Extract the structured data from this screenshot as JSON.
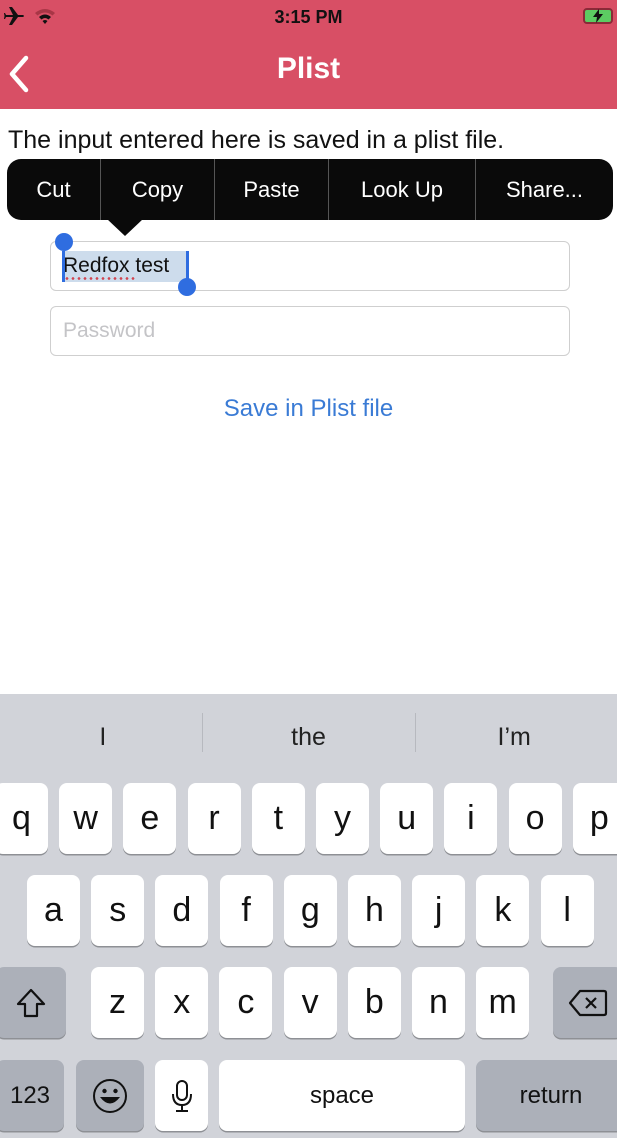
{
  "status_bar": {
    "time": "3:15 PM",
    "left_icons": [
      "airplane-icon",
      "wifi-icon"
    ],
    "battery": "charging"
  },
  "nav": {
    "title": "Plist",
    "back_icon": "chevron-left-icon"
  },
  "description": "The input entered here is saved in a plist file.",
  "edit_menu": {
    "items": [
      "Cut",
      "Copy",
      "Paste",
      "Look Up",
      "Share..."
    ]
  },
  "form": {
    "username_value": "Redfox test",
    "password_placeholder": "Password",
    "save_label": "Save in Plist file"
  },
  "colors": {
    "header": "#d84f65",
    "accent": "#3a7bd5",
    "selection": "#2f6de0"
  },
  "keyboard": {
    "suggestions": [
      "I",
      "the",
      "I’m"
    ],
    "row1": [
      "q",
      "w",
      "e",
      "r",
      "t",
      "y",
      "u",
      "i",
      "o",
      "p"
    ],
    "row2": [
      "a",
      "s",
      "d",
      "f",
      "g",
      "h",
      "j",
      "k",
      "l"
    ],
    "row3": [
      "z",
      "x",
      "c",
      "v",
      "b",
      "n",
      "m"
    ],
    "numbers_label": "123",
    "space_label": "space",
    "return_label": "return"
  }
}
